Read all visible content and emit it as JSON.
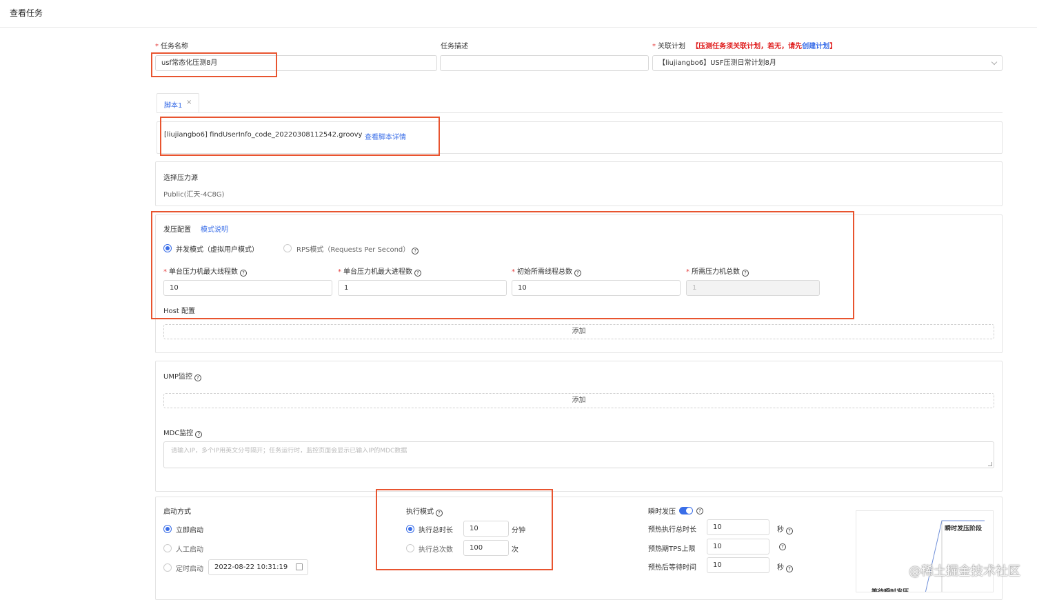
{
  "page": {
    "title": "查看任务"
  },
  "task": {
    "name_label": "任务名称",
    "name_value": "usf常态化压测8月",
    "desc_label": "任务描述",
    "desc_value": "",
    "plan_label": "关联计划",
    "plan_warn_prefix": "【压测任务须关联计划，若无，请先",
    "plan_warn_link": "创建计划",
    "plan_warn_suffix": "】",
    "plan_value": "【liujiangbo6】USF压测日常计划8月"
  },
  "script": {
    "tab_label": "脚本1",
    "tab_close": "×",
    "file": "[liujiangbo6] findUserInfo_code_20220308112542.groovy",
    "detail_link": "查看脚本详情"
  },
  "source": {
    "label": "选择压力源",
    "value": "Public(汇天-4C8G)"
  },
  "pressure": {
    "label": "发压配置",
    "mode_link": "模式说明",
    "mode_concurrent": "并发模式（虚拟用户模式）",
    "mode_rps": "RPS模式（Requests Per Second）",
    "fields": [
      {
        "label": "单台压力机最大线程数",
        "value": "10"
      },
      {
        "label": "单台压力机最大进程数",
        "value": "1"
      },
      {
        "label": "初始所需线程总数",
        "value": "10"
      },
      {
        "label": "所需压力机总数",
        "value": "1"
      }
    ],
    "host_label": "Host 配置",
    "add_label": "添加"
  },
  "monitor": {
    "ump_label": "UMP监控",
    "add_label": "添加",
    "mdc_label": "MDC监控",
    "mdc_placeholder": "请输入IP，多个IP用英文分号隔开；任务运行时，监控页面会显示已输入IP的MDC数据"
  },
  "start": {
    "label": "启动方式",
    "immediate": "立即启动",
    "manual": "人工启动",
    "scheduled": "定时启动",
    "scheduled_value": "2022-08-22 10:31:19"
  },
  "exec": {
    "label": "执行模式",
    "duration_label": "执行总时长",
    "duration_value": "10",
    "duration_unit": "分钟",
    "count_label": "执行总次数",
    "count_value": "100",
    "count_unit": "次"
  },
  "burst": {
    "label": "瞬时发压",
    "preheat_duration_label": "预热执行总时长",
    "preheat_duration_value": "10",
    "preheat_duration_unit": "秒",
    "preheat_tps_label": "预热期TPS上限",
    "preheat_tps_value": "10",
    "wait_label": "预热后等待时间",
    "wait_value": "10",
    "wait_unit": "秒",
    "chart_label_top": "瞬时发压阶段",
    "chart_label_bottom": "等待瞬时发压"
  },
  "watermark": "@稀土掘金技术社区",
  "colors": {
    "accent": "#3a6ee8",
    "warn": "#e02020",
    "highlight": "#e8542f"
  }
}
